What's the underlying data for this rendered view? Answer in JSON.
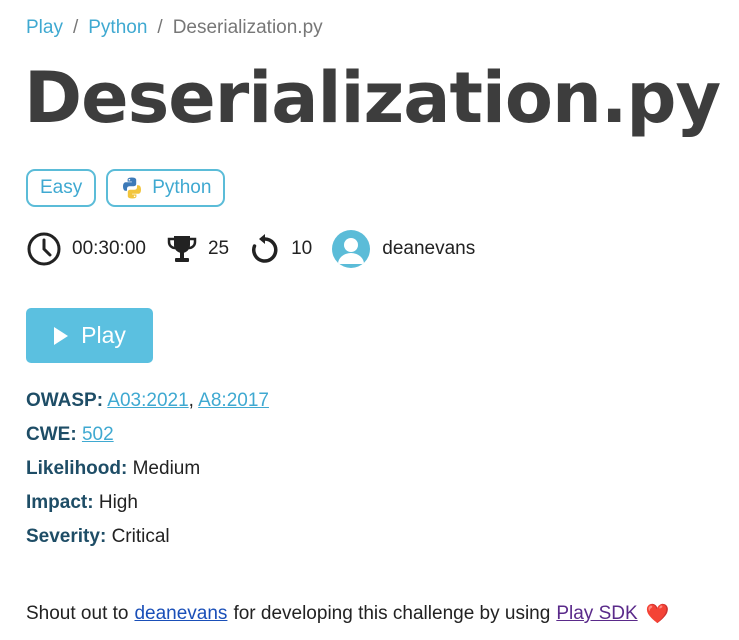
{
  "breadcrumb": {
    "items": [
      {
        "label": "Play"
      },
      {
        "label": "Python"
      }
    ],
    "separator": "/",
    "current": "Deserialization.py"
  },
  "title": "Deserialization.py",
  "tags": {
    "difficulty": "Easy",
    "language": "Python"
  },
  "meta": {
    "duration": "00:30:00",
    "points": "25",
    "attempts": "10",
    "author": "deanevans"
  },
  "play_button": {
    "label": "Play"
  },
  "details": {
    "owasp": {
      "key": "OWASP:",
      "links": [
        "A03:2021",
        "A8:2017"
      ],
      "separator": ","
    },
    "cwe": {
      "key": "CWE:",
      "link": "502"
    },
    "likelihood": {
      "key": "Likelihood:",
      "value": "Medium"
    },
    "impact": {
      "key": "Impact:",
      "value": "High"
    },
    "severity": {
      "key": "Severity:",
      "value": "Critical"
    }
  },
  "shoutout": {
    "prefix": "Shout out to",
    "user": "deanevans",
    "middle": "for developing this challenge by using",
    "sdk": "Play SDK",
    "heart": "❤️"
  },
  "colors": {
    "accent": "#5bc0e0",
    "link": "#3fa9d1",
    "detail_key": "#1e4d66",
    "title": "#3d3d3d"
  }
}
